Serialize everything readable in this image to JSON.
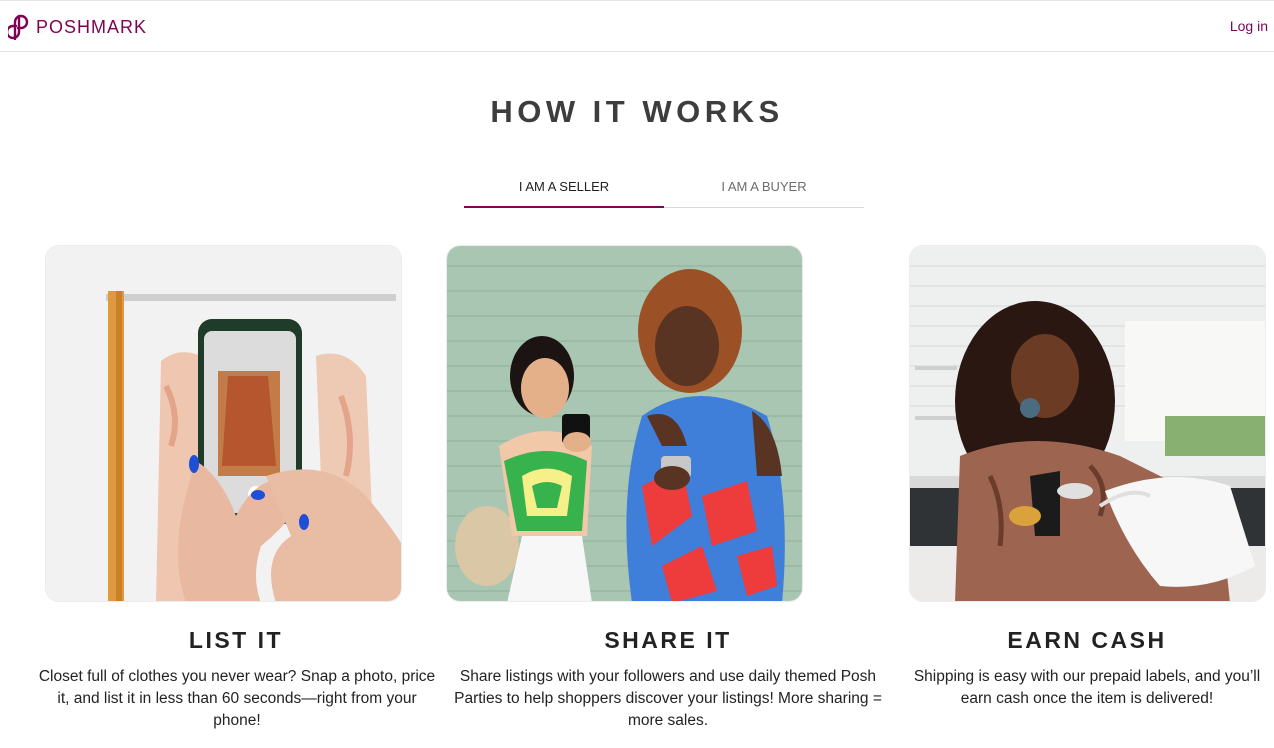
{
  "header": {
    "brand": "POSHMARK",
    "login_label": "Log in",
    "brand_color": "#7f0353"
  },
  "page": {
    "title": "HOW IT WORKS"
  },
  "tabs": [
    {
      "label": "I AM A SELLER",
      "active": true
    },
    {
      "label": "I AM A BUYER",
      "active": false
    }
  ],
  "cards": [
    {
      "title": "LIST IT",
      "description": "Closet full of clothes you never wear? Snap a photo, price it, and list it in less than 60 seconds—right from your phone!",
      "image": "hands-photographing-clothes-on-rack-with-phone"
    },
    {
      "title": "SHARE IT",
      "description": "Share listings with your followers and use daily themed Posh Parties to help shoppers discover your listings! More sharing = more sales.",
      "image": "two-women-laughing-looking-at-phones"
    },
    {
      "title": "EARN CASH",
      "description": "Shipping is easy with our prepaid labels, and you’ll earn cash once the item is delivered!",
      "image": "woman-packing-item-in-dust-bag-kitchen"
    }
  ]
}
